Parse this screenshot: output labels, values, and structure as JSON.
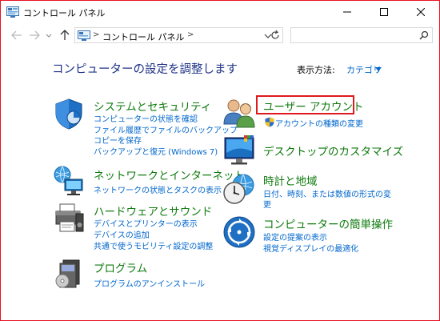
{
  "window": {
    "title": "コントロール パネル"
  },
  "address": {
    "crumbs": [
      "コントロール パネル"
    ]
  },
  "search": {
    "placeholder": ""
  },
  "heading": "コンピューターの設定を調整します",
  "view_by": {
    "label": "表示方法:",
    "value": "カテゴリ"
  },
  "categories": [
    {
      "title": "システムとセキュリティ",
      "icon": "shield-icon",
      "links": [
        "コンピューターの状態を確認",
        "ファイル履歴でファイルのバックアップ",
        "コピーを保存",
        "バックアップと復元 (Windows 7)"
      ]
    },
    {
      "title": "ネットワークとインターネット",
      "icon": "network-icon",
      "links": [
        "ネットワークの状態とタスクの表示"
      ]
    },
    {
      "title": "ハードウェアとサウンド",
      "icon": "printer-icon",
      "links": [
        "デバイスとプリンターの表示",
        "デバイスの追加",
        "共通で使うモビリティ設定の調整"
      ]
    },
    {
      "title": "プログラム",
      "icon": "programs-icon",
      "links": [
        "プログラムのアンインストール"
      ]
    },
    {
      "title": "ユーザー アカウント",
      "icon": "users-icon",
      "links": [
        "アカウントの種類の変更"
      ]
    },
    {
      "title": "デスクトップのカスタマイズ",
      "icon": "desktop-icon",
      "links": []
    },
    {
      "title": "時計と地域",
      "icon": "clock-icon",
      "links": [
        "日付、時刻、または数値の形式の変",
        "更"
      ]
    },
    {
      "title": "コンピューターの簡単操作",
      "icon": "ease-of-access-icon",
      "links": [
        "設定の提案の表示",
        "視覚ディスプレイの最適化"
      ]
    }
  ],
  "colors": {
    "category_title": "#0e7a0d",
    "link": "#0066cc",
    "heading": "#1e3287",
    "highlight": "#e0191e"
  }
}
